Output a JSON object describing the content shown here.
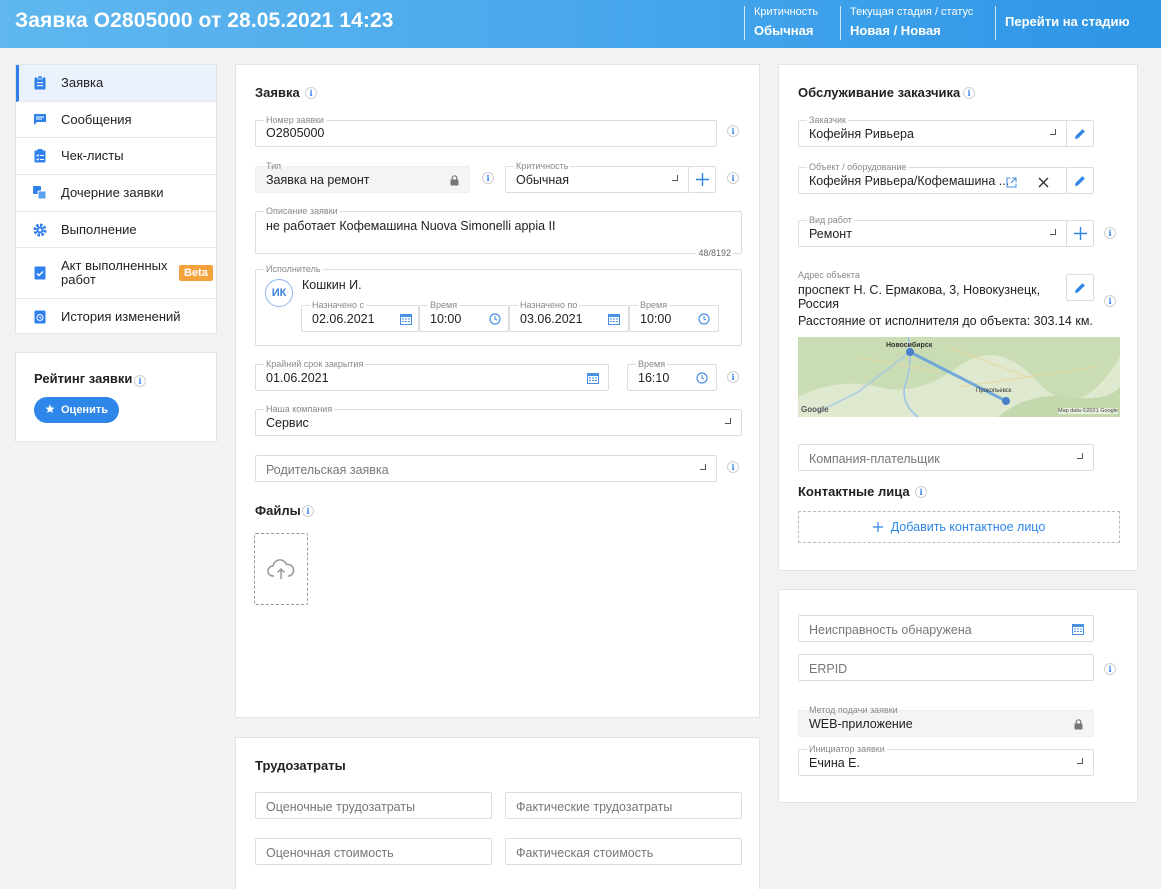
{
  "header": {
    "title": "Заявка O2805000 от 28.05.2021 14:23",
    "criticality_label": "Критичность",
    "criticality_value": "Обычная",
    "stage_label": "Текущая стадия / статус",
    "stage_value": "Новая / Новая",
    "goto_stage": "Перейти на стадию"
  },
  "nav": {
    "items": [
      {
        "label": "Заявка",
        "icon": "clipboard-icon"
      },
      {
        "label": "Сообщения",
        "icon": "message-icon"
      },
      {
        "label": "Чек-листы",
        "icon": "checklist-icon"
      },
      {
        "label": "Дочерние заявки",
        "icon": "child-requests-icon"
      },
      {
        "label": "Выполнение",
        "icon": "gear-icon"
      },
      {
        "label": "Акт выполненных работ",
        "icon": "act-icon",
        "badge": "Beta"
      },
      {
        "label": "История изменений",
        "icon": "history-icon"
      }
    ]
  },
  "rating": {
    "title": "Рейтинг заявки",
    "button": "Оценить"
  },
  "request": {
    "title": "Заявка",
    "number_label": "Номер заявки",
    "number_value": "O2805000",
    "type_label": "Тип",
    "type_value": "Заявка на ремонт",
    "criticality_label": "Критичность",
    "criticality_value": "Обычная",
    "description_label": "Описание заявки",
    "description_value": "не работает Кофемашина Nuova Simonelli appia II",
    "description_counter": "48/8192",
    "executor_label": "Исполнитель",
    "executor_initials": "ИК",
    "executor_name": "Кошкин И.",
    "assigned_from_label": "Назначено с",
    "assigned_from_value": "02.06.2021",
    "time1_label": "Время",
    "time1_value": "10:00",
    "assigned_to_label": "Назначено по",
    "assigned_to_value": "03.06.2021",
    "time2_label": "Время",
    "time2_value": "10:00",
    "deadline_label": "Крайний срок закрытия",
    "deadline_value": "01.06.2021",
    "deadline_time_label": "Время",
    "deadline_time_value": "16:10",
    "company_label": "Наша компания",
    "company_value": "Сервис",
    "parent_placeholder": "Родительская заявка",
    "files_title": "Файлы"
  },
  "labor": {
    "title": "Трудозатраты",
    "estimated_labor": "Оценочные трудозатраты",
    "actual_labor": "Фактические трудозатраты",
    "estimated_cost": "Оценочная стоимость",
    "actual_cost": "Фактическая стоимость"
  },
  "customer": {
    "title": "Обслуживание заказчика",
    "customer_label": "Заказчик",
    "customer_value": "Кофейня Ривьера",
    "object_label": "Объект / оборудование",
    "object_value": "Кофейня Ривьера/Кофемашина ...",
    "work_type_label": "Вид работ",
    "work_type_value": "Ремонт",
    "address_label": "Адрес объекта",
    "address_line1": "проспект Н. С. Ермакова, 3, Новокузнецк,",
    "address_line2": "Россия",
    "distance": "Расстояние от исполнителя до объекта: 303.14 км.",
    "payer_placeholder": "Компания-плательщик",
    "contacts_title": "Контактные лица",
    "add_contact": "Добавить контактное лицо"
  },
  "map": {
    "city1": "Новосибирск",
    "city2": "Прокопьевск",
    "google": "Google",
    "attribution": "Map data ©2021 Google"
  },
  "extra": {
    "fault_placeholder": "Неисправность обнаружена",
    "erpid_placeholder": "ERPID",
    "method_label": "Метод подачи заявки",
    "method_value": "WEB-приложение",
    "initiator_label": "Инициатор заявки",
    "initiator_value": "Ечина Е."
  },
  "colors": {
    "accent": "#2d86e8",
    "header_start": "#5fb7ee",
    "header_end": "#2d95e6",
    "beta": "#f6a23c"
  }
}
